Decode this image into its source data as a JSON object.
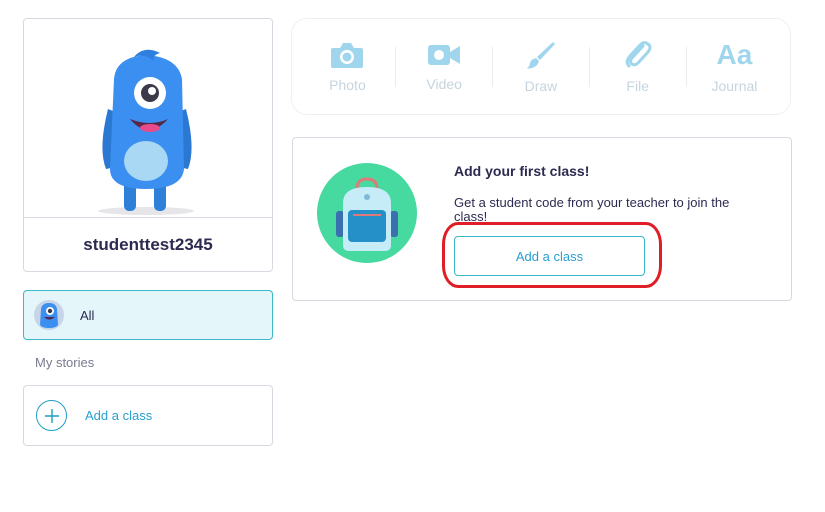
{
  "profile": {
    "username": "studenttest2345",
    "avatar_icon": "blue-monster-avatar"
  },
  "sidebar": {
    "all_label": "All",
    "section_label": "My stories",
    "add_class_label": "Add a class"
  },
  "toolbar": {
    "items": [
      {
        "label": "Photo",
        "icon": "camera-icon"
      },
      {
        "label": "Video",
        "icon": "video-camera-icon"
      },
      {
        "label": "Draw",
        "icon": "paintbrush-icon"
      },
      {
        "label": "File",
        "icon": "paperclip-icon"
      },
      {
        "label": "Journal",
        "icon": "aa-text-icon",
        "glyph": "Aa"
      }
    ]
  },
  "class_prompt": {
    "title": "Add your first class!",
    "description": "Get a student code from your teacher to join the class!",
    "button_label": "Add a class",
    "icon": "backpack-icon"
  },
  "colors": {
    "accent": "#2a9fd0",
    "teal_border": "#3cb6c4",
    "highlight": "#e01e28",
    "backpack_bg": "#46d9a0",
    "toolbar_icon": "#9fd6ee"
  }
}
